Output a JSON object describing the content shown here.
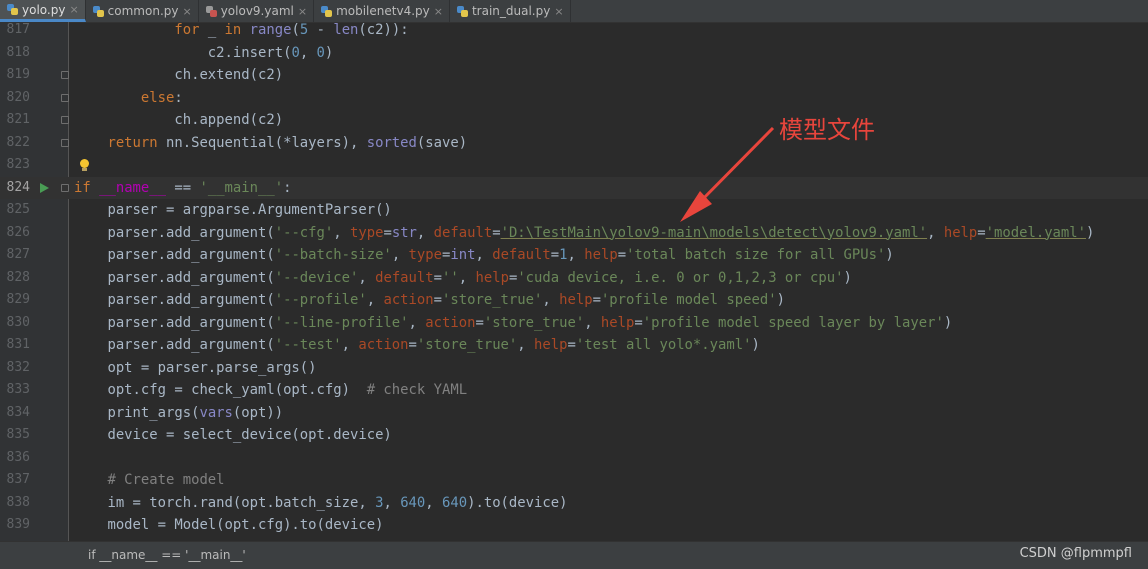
{
  "tabs": [
    {
      "label": "yolo.py",
      "active": true,
      "icon": "python-file-icon"
    },
    {
      "label": "common.py",
      "active": false,
      "icon": "python-file-icon"
    },
    {
      "label": "yolov9.yaml",
      "active": false,
      "icon": "yaml-file-icon"
    },
    {
      "label": "mobilenetv4.py",
      "active": false,
      "icon": "python-file-icon"
    },
    {
      "label": "train_dual.py",
      "active": false,
      "icon": "python-file-icon"
    }
  ],
  "tab_close_glyph": "×",
  "editor": {
    "current_line": "824",
    "lines": [
      {
        "n": "817",
        "tokens": [
          [
            "",
            "            "
          ],
          [
            "kw",
            "for"
          ],
          [
            "",
            " _ "
          ],
          [
            "kw",
            "in"
          ],
          [
            "",
            " "
          ],
          [
            "bi",
            "range"
          ],
          [
            "",
            "("
          ],
          [
            "num",
            "5"
          ],
          [
            "",
            " - "
          ],
          [
            "bi",
            "len"
          ],
          [
            "",
            "(c2)):"
          ]
        ]
      },
      {
        "n": "818",
        "tokens": [
          [
            "",
            "                c2.insert("
          ],
          [
            "num",
            "0"
          ],
          [
            "",
            ", "
          ],
          [
            "num",
            "0"
          ],
          [
            "",
            ")"
          ]
        ]
      },
      {
        "n": "819",
        "fold": true,
        "tokens": [
          [
            "",
            "            ch.extend(c2)"
          ]
        ]
      },
      {
        "n": "820",
        "fold": true,
        "tokens": [
          [
            "",
            "        "
          ],
          [
            "kw",
            "else"
          ],
          [
            "",
            ":"
          ]
        ]
      },
      {
        "n": "821",
        "fold": true,
        "tokens": [
          [
            "",
            "            ch.append(c2)"
          ]
        ]
      },
      {
        "n": "822",
        "fold": true,
        "tokens": [
          [
            "",
            "    "
          ],
          [
            "kw",
            "return"
          ],
          [
            "",
            " nn.Sequential(*layers), "
          ],
          [
            "bi",
            "sorted"
          ],
          [
            "",
            "(save)"
          ]
        ]
      },
      {
        "n": "823",
        "bulb": true,
        "tokens": []
      },
      {
        "n": "824",
        "run": true,
        "fold": true,
        "tokens": [
          [
            "kw",
            "if"
          ],
          [
            "",
            " "
          ],
          [
            "dm",
            "__name__"
          ],
          [
            "",
            " == "
          ],
          [
            "str",
            "'__main__'"
          ],
          [
            "",
            ":"
          ]
        ]
      },
      {
        "n": "825",
        "tokens": [
          [
            "",
            "    parser = argparse.ArgumentParser()"
          ]
        ]
      },
      {
        "n": "826",
        "tokens": [
          [
            "",
            "    parser.add_argument("
          ],
          [
            "str",
            "'--cfg'"
          ],
          [
            "",
            ", "
          ],
          [
            "kwa",
            "type"
          ],
          [
            "",
            "="
          ],
          [
            "bi",
            "str"
          ],
          [
            "",
            ", "
          ],
          [
            "kwa",
            "default"
          ],
          [
            "",
            "="
          ],
          [
            "str uline",
            "'D:\\TestMain\\yolov9-main\\models\\detect\\yolov9.yaml'"
          ],
          [
            "",
            ", "
          ],
          [
            "kwa",
            "help"
          ],
          [
            "",
            "="
          ],
          [
            "str uline",
            "'model.yaml'"
          ],
          [
            "",
            ")"
          ]
        ]
      },
      {
        "n": "827",
        "tokens": [
          [
            "",
            "    parser.add_argument("
          ],
          [
            "str",
            "'--batch-size'"
          ],
          [
            "",
            ", "
          ],
          [
            "kwa",
            "type"
          ],
          [
            "",
            "="
          ],
          [
            "bi",
            "int"
          ],
          [
            "",
            ", "
          ],
          [
            "kwa",
            "default"
          ],
          [
            "",
            "="
          ],
          [
            "num",
            "1"
          ],
          [
            "",
            ", "
          ],
          [
            "kwa",
            "help"
          ],
          [
            "",
            "="
          ],
          [
            "str",
            "'total batch size for all GPUs'"
          ],
          [
            "",
            ")"
          ]
        ]
      },
      {
        "n": "828",
        "tokens": [
          [
            "",
            "    parser.add_argument("
          ],
          [
            "str",
            "'--device'"
          ],
          [
            "",
            ", "
          ],
          [
            "kwa",
            "default"
          ],
          [
            "",
            "="
          ],
          [
            "str",
            "''"
          ],
          [
            "",
            ", "
          ],
          [
            "kwa",
            "help"
          ],
          [
            "",
            "="
          ],
          [
            "str",
            "'cuda device, i.e. 0 or 0,1,2,3 or cpu'"
          ],
          [
            "",
            ")"
          ]
        ]
      },
      {
        "n": "829",
        "tokens": [
          [
            "",
            "    parser.add_argument("
          ],
          [
            "str",
            "'--profile'"
          ],
          [
            "",
            ", "
          ],
          [
            "kwa",
            "action"
          ],
          [
            "",
            "="
          ],
          [
            "str",
            "'store_true'"
          ],
          [
            "",
            ", "
          ],
          [
            "kwa",
            "help"
          ],
          [
            "",
            "="
          ],
          [
            "str",
            "'profile model speed'"
          ],
          [
            "",
            ")"
          ]
        ]
      },
      {
        "n": "830",
        "tokens": [
          [
            "",
            "    parser.add_argument("
          ],
          [
            "str",
            "'--line-profile'"
          ],
          [
            "",
            ", "
          ],
          [
            "kwa",
            "action"
          ],
          [
            "",
            "="
          ],
          [
            "str",
            "'store_true'"
          ],
          [
            "",
            ", "
          ],
          [
            "kwa",
            "help"
          ],
          [
            "",
            "="
          ],
          [
            "str",
            "'profile model speed layer by layer'"
          ],
          [
            "",
            ")"
          ]
        ]
      },
      {
        "n": "831",
        "tokens": [
          [
            "",
            "    parser.add_argument("
          ],
          [
            "str",
            "'--test'"
          ],
          [
            "",
            ", "
          ],
          [
            "kwa",
            "action"
          ],
          [
            "",
            "="
          ],
          [
            "str",
            "'store_true'"
          ],
          [
            "",
            ", "
          ],
          [
            "kwa",
            "help"
          ],
          [
            "",
            "="
          ],
          [
            "str",
            "'test all yolo*.yaml'"
          ],
          [
            "",
            ")"
          ]
        ]
      },
      {
        "n": "832",
        "tokens": [
          [
            "",
            "    opt = parser.parse_args()"
          ]
        ]
      },
      {
        "n": "833",
        "tokens": [
          [
            "",
            "    opt.cfg = check_yaml(opt.cfg)  "
          ],
          [
            "cmt",
            "# check YAML"
          ]
        ]
      },
      {
        "n": "834",
        "tokens": [
          [
            "",
            "    print_args("
          ],
          [
            "bi",
            "vars"
          ],
          [
            "",
            "(opt))"
          ]
        ]
      },
      {
        "n": "835",
        "tokens": [
          [
            "",
            "    device = select_device(opt.device)"
          ]
        ]
      },
      {
        "n": "836",
        "tokens": []
      },
      {
        "n": "837",
        "tokens": [
          [
            "",
            "    "
          ],
          [
            "cmt",
            "# Create model"
          ]
        ]
      },
      {
        "n": "838",
        "tokens": [
          [
            "",
            "    im = torch.rand(opt.batch_size, "
          ],
          [
            "num",
            "3"
          ],
          [
            "",
            ", "
          ],
          [
            "num",
            "640"
          ],
          [
            "",
            ", "
          ],
          [
            "num",
            "640"
          ],
          [
            "",
            ").to(device)"
          ]
        ]
      },
      {
        "n": "839",
        "tokens": [
          [
            "",
            "    model = Model(opt.cfg).to(device)"
          ]
        ]
      }
    ]
  },
  "annotation": {
    "text": "模型文件",
    "color": "#e8453c"
  },
  "statusbar": {
    "breadcrumb": "if __name__ == '__main__'",
    "watermark": "CSDN @flpmmpfl"
  },
  "colors": {
    "background": "#2b2b2b",
    "keyword": "#cc7832",
    "string": "#6a8759",
    "number": "#6897bb",
    "comment": "#808080",
    "builtin": "#8888c6",
    "kwarg": "#aa4926"
  }
}
